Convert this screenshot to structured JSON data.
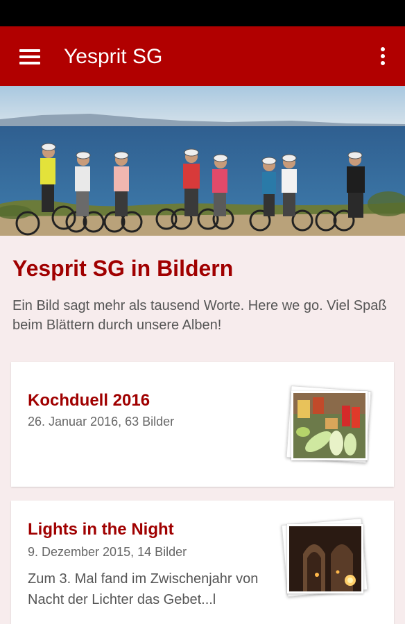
{
  "app_bar": {
    "title": "Yesprit SG",
    "menu_icon": "hamburger-menu-icon",
    "overflow_icon": "more-vert-icon",
    "color": "#b10000"
  },
  "hero": {
    "image": "group-photo-cyclists-seaside"
  },
  "main": {
    "title": "Yesprit SG in Bildern",
    "intro": "Ein Bild sagt mehr als tausend Worte. Here we go. Viel Spaß beim Blättern durch unsere Alben!"
  },
  "albums": [
    {
      "title": "Kochduell 2016",
      "meta": "26. Januar 2016, 63 Bilder",
      "thumbnail": "vegetables-photo-stack"
    },
    {
      "title": "Lights in the Night",
      "meta": "9. Dezember 2015, 14 Bilder",
      "description": "Zum 3. Mal fand im Zwischenjahr von Nacht der Lichter das Gebet...l",
      "thumbnail": "candlelit-church-photo-stack"
    }
  ],
  "colors": {
    "accent": "#a00000",
    "background": "#f7eced"
  }
}
